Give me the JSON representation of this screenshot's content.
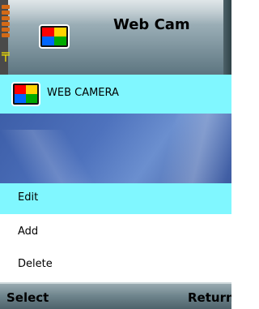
{
  "header": {
    "title": "Web Cam",
    "app_icon": "color-bars-icon",
    "battery_icon": "battery-icon",
    "signal_icon": "signal-icon"
  },
  "item": {
    "label": "WEB CAMERA",
    "icon": "color-bars-icon"
  },
  "menu": {
    "items": [
      {
        "label": "Edit",
        "selected": true
      },
      {
        "label": "Add"
      },
      {
        "label": "Delete"
      }
    ]
  },
  "softkeys": {
    "left": "Select",
    "right": "Return"
  },
  "colors": {
    "highlight": "#80f7ff",
    "accent": "#d36a17",
    "signal": "#f2e000",
    "wallpaper": "#4e72bd"
  }
}
